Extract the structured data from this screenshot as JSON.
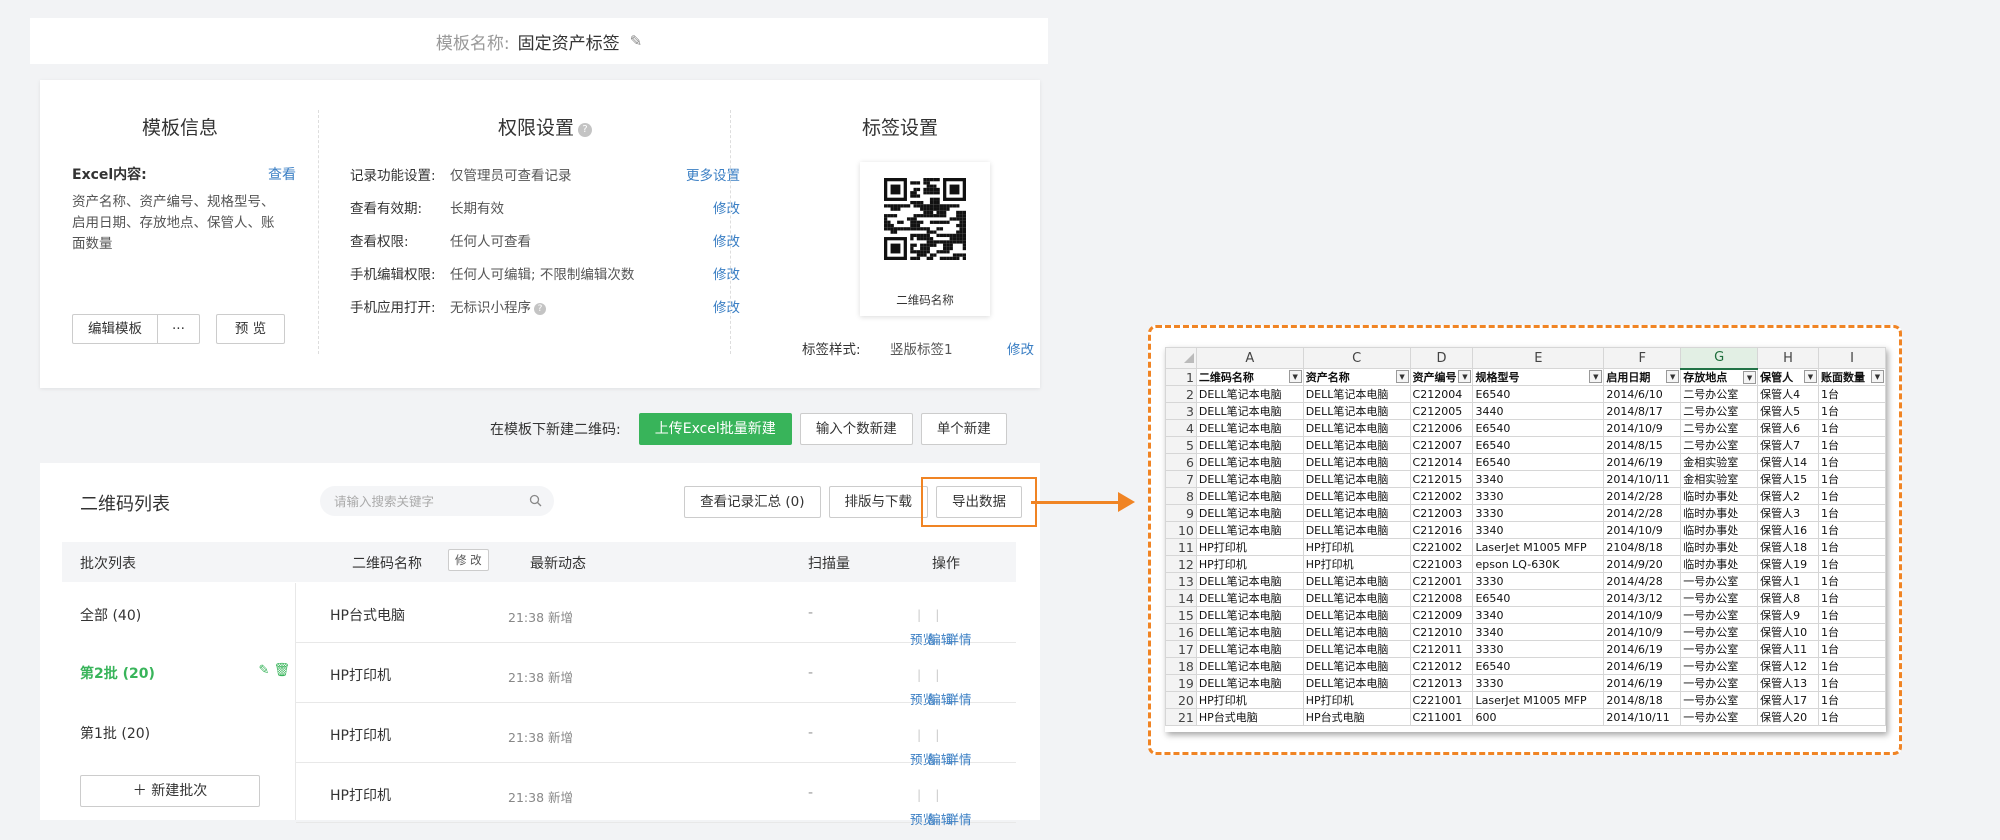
{
  "template_bar": {
    "label": "模板名称:",
    "value": "固定资产标签"
  },
  "template_info": {
    "title": "模板信息",
    "excel_label": "Excel内容:",
    "excel_view": "查看",
    "excel_fields": "资产名称、资产编号、规格型号、启用日期、存放地点、保管人、账面数量",
    "edit_button": "编辑模板",
    "more_button": "···",
    "preview_button": "预 览"
  },
  "permissions": {
    "title": "权限设置",
    "rows": [
      {
        "key": "记录功能设置:",
        "value": "仅管理员可查看记录",
        "action": "更多设置"
      },
      {
        "key": "查看有效期:",
        "value": "长期有效",
        "action": "修改"
      },
      {
        "key": "查看权限:",
        "value": "任何人可查看",
        "action": "修改"
      },
      {
        "key": "手机编辑权限:",
        "value": "任何人可编辑; 不限制编辑次数",
        "action": "修改"
      },
      {
        "key": "手机应用打开:",
        "value": "无标识小程序",
        "action": "修改"
      }
    ]
  },
  "label_settings": {
    "title": "标签设置",
    "qr_caption": "二维码名称",
    "style_label": "标签样式:",
    "style_value": "竖版标签1",
    "style_action": "修改"
  },
  "new_row": {
    "label": "在模板下新建二维码:",
    "upload_excel": "上传Excel批量新建",
    "input_count": "输入个数新建",
    "single_new": "单个新建"
  },
  "list": {
    "title": "二维码列表",
    "search_placeholder": "请输入搜索关键字",
    "records_button": "查看记录汇总 (0)",
    "layout_button": "排版与下载",
    "export_button": "导出数据",
    "headers": {
      "batch": "批次列表",
      "name": "二维码名称",
      "modify": "修 改",
      "latest": "最新动态",
      "scans": "扫描量",
      "ops": "操作"
    },
    "batches": [
      {
        "label": "全部 (40)"
      },
      {
        "label": "第2批 (20)"
      },
      {
        "label": "第1批 (20)"
      }
    ],
    "new_batch": "新建批次",
    "rows": [
      {
        "name": "HP台式电脑",
        "latest": "21:38 新增",
        "scans": "-"
      },
      {
        "name": "HP打印机",
        "latest": "21:38 新增",
        "scans": "-"
      },
      {
        "name": "HP打印机",
        "latest": "21:38 新增",
        "scans": "-"
      },
      {
        "name": "HP打印机",
        "latest": "21:38 新增",
        "scans": "-"
      }
    ],
    "ops": {
      "preview": "预览",
      "edit": "编辑",
      "detail": "详情"
    }
  },
  "excel": {
    "columns": [
      "A",
      "C",
      "D",
      "E",
      "F",
      "G",
      "H",
      "I"
    ],
    "selected_column": "G",
    "headers": [
      "二维码名称",
      "资产名称",
      "资产编号",
      "规格型号",
      "启用日期",
      "存放地点",
      "保管人",
      "账面数量"
    ],
    "rows": [
      [
        "DELL笔记本电脑",
        "DELL笔记本电脑",
        "C212004",
        "E6540",
        "2014/6/10",
        "二号办公室",
        "保管人4",
        "1台"
      ],
      [
        "DELL笔记本电脑",
        "DELL笔记本电脑",
        "C212005",
        "3440",
        "2014/8/17",
        "二号办公室",
        "保管人5",
        "1台"
      ],
      [
        "DELL笔记本电脑",
        "DELL笔记本电脑",
        "C212006",
        "E6540",
        "2014/10/9",
        "二号办公室",
        "保管人6",
        "1台"
      ],
      [
        "DELL笔记本电脑",
        "DELL笔记本电脑",
        "C212007",
        "E6540",
        "2014/8/15",
        "二号办公室",
        "保管人7",
        "1台"
      ],
      [
        "DELL笔记本电脑",
        "DELL笔记本电脑",
        "C212014",
        "E6540",
        "2014/6/19",
        "金相实验室",
        "保管人14",
        "1台"
      ],
      [
        "DELL笔记本电脑",
        "DELL笔记本电脑",
        "C212015",
        "3340",
        "2014/10/11",
        "金相实验室",
        "保管人15",
        "1台"
      ],
      [
        "DELL笔记本电脑",
        "DELL笔记本电脑",
        "C212002",
        "3330",
        "2014/2/28",
        "临时办事处",
        "保管人2",
        "1台"
      ],
      [
        "DELL笔记本电脑",
        "DELL笔记本电脑",
        "C212003",
        "3330",
        "2014/2/28",
        "临时办事处",
        "保管人3",
        "1台"
      ],
      [
        "DELL笔记本电脑",
        "DELL笔记本电脑",
        "C212016",
        "3340",
        "2014/10/9",
        "临时办事处",
        "保管人16",
        "1台"
      ],
      [
        "HP打印机",
        "HP打印机",
        "C221002",
        "LaserJet M1005 MFP",
        "2104/8/18",
        "临时办事处",
        "保管人18",
        "1台"
      ],
      [
        "HP打印机",
        "HP打印机",
        "C221003",
        "epson LQ-630K",
        "2014/9/20",
        "临时办事处",
        "保管人19",
        "1台"
      ],
      [
        "DELL笔记本电脑",
        "DELL笔记本电脑",
        "C212001",
        "3330",
        "2014/4/28",
        "一号办公室",
        "保管人1",
        "1台"
      ],
      [
        "DELL笔记本电脑",
        "DELL笔记本电脑",
        "C212008",
        "E6540",
        "2014/3/12",
        "一号办公室",
        "保管人8",
        "1台"
      ],
      [
        "DELL笔记本电脑",
        "DELL笔记本电脑",
        "C212009",
        "3340",
        "2014/10/9",
        "一号办公室",
        "保管人9",
        "1台"
      ],
      [
        "DELL笔记本电脑",
        "DELL笔记本电脑",
        "C212010",
        "3340",
        "2014/10/9",
        "一号办公室",
        "保管人10",
        "1台"
      ],
      [
        "DELL笔记本电脑",
        "DELL笔记本电脑",
        "C212011",
        "3330",
        "2014/6/19",
        "一号办公室",
        "保管人11",
        "1台"
      ],
      [
        "DELL笔记本电脑",
        "DELL笔记本电脑",
        "C212012",
        "E6540",
        "2014/6/19",
        "一号办公室",
        "保管人12",
        "1台"
      ],
      [
        "DELL笔记本电脑",
        "DELL笔记本电脑",
        "C212013",
        "3330",
        "2014/6/19",
        "一号办公室",
        "保管人13",
        "1台"
      ],
      [
        "HP打印机",
        "HP打印机",
        "C221001",
        "LaserJet M1005 MFP",
        "2014/8/18",
        "一号办公室",
        "保管人17",
        "1台"
      ],
      [
        "HP台式电脑",
        "HP台式电脑",
        "C211001",
        "600",
        "2014/10/11",
        "一号办公室",
        "保管人20",
        "1台"
      ]
    ]
  },
  "colors": {
    "accent_green": "#38b45a",
    "link_blue": "#3b7fc4",
    "highlight_orange": "#f08424"
  }
}
